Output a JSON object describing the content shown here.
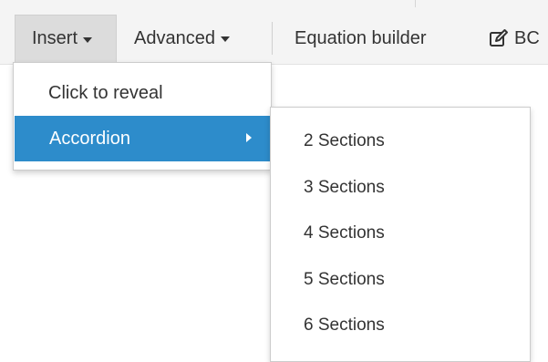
{
  "toolbar": {
    "insert_label": "Insert",
    "advanced_label": "Advanced",
    "equation_label": "Equation builder",
    "bc_label": "BC",
    "bc_icon": "edit-icon"
  },
  "insert_menu": {
    "items": [
      {
        "label": "Click to reveal",
        "active": false
      },
      {
        "label": "Accordion",
        "active": true,
        "has_submenu": true
      }
    ]
  },
  "accordion_submenu": {
    "items": [
      {
        "label": "2 Sections"
      },
      {
        "label": "3 Sections"
      },
      {
        "label": "4 Sections"
      },
      {
        "label": "5 Sections"
      },
      {
        "label": "6 Sections"
      }
    ]
  },
  "colors": {
    "active_bg": "#2d8ccb",
    "toolbar_bg": "#f4f4f4",
    "text": "#333333"
  }
}
